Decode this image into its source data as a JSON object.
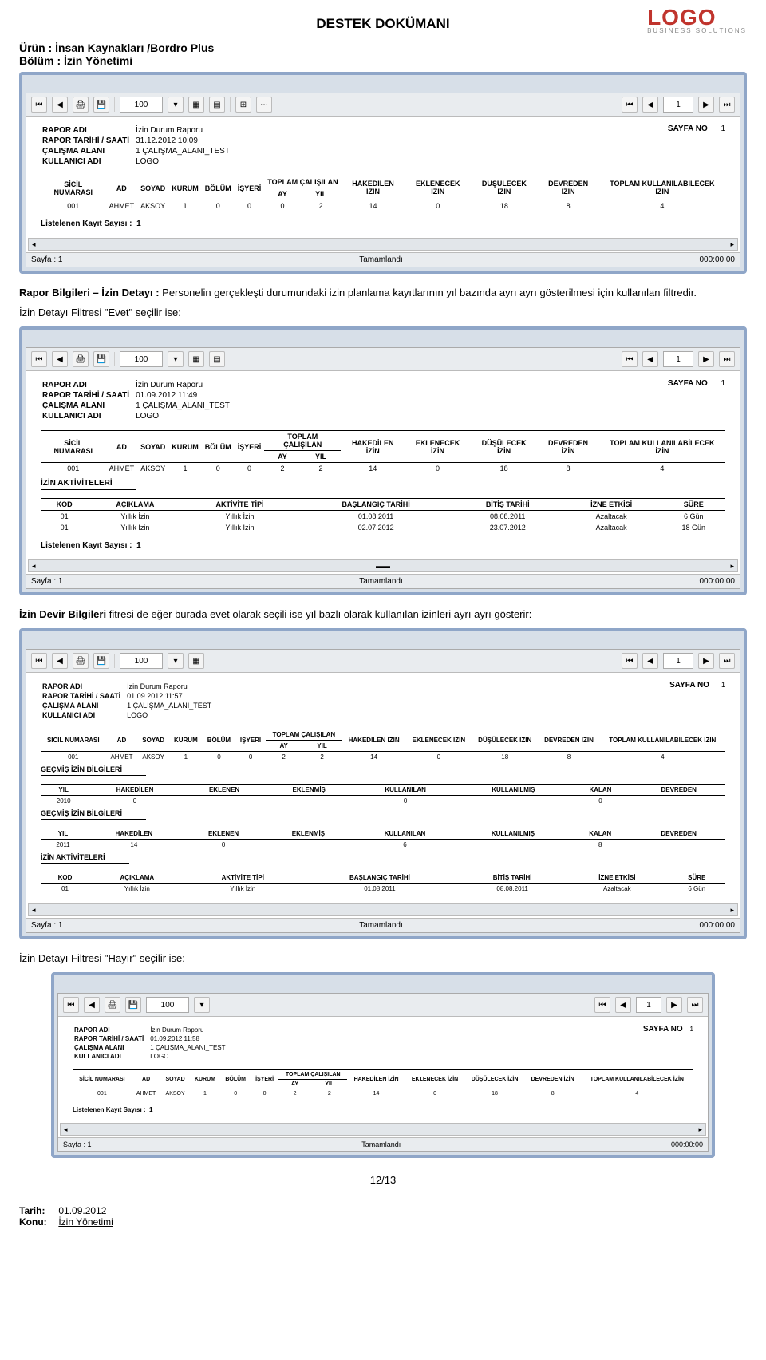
{
  "doc": {
    "title": "DESTEK DOKÜMANI",
    "product_label": "Ürün",
    "product_value": ": İnsan Kaynakları /Bordro Plus",
    "section_label": "Bölüm",
    "section_value": ": İzin Yönetimi",
    "logo_text": "LOGO",
    "logo_sub": "BUSINESS SOLUTIONS"
  },
  "paras": {
    "p1_label": "Rapor Bilgileri – İzin Detayı :",
    "p1_text": " Personelin gerçekleşti durumundaki izin planlama kayıtlarının yıl bazında ayrı ayrı gösterilmesi için kullanılan filtredir.",
    "p2": "İzin Detayı Filtresi \"Evet\" seçilir ise:",
    "p3_label": "İzin Devir Bilgileri",
    "p3_text": " fitresi de eğer burada evet olarak seçili ise yıl bazlı olarak kullanılan izinleri ayrı ayrı gösterir:",
    "p4": "İzin Detayı Filtresi \"Hayır\" seçilir ise:"
  },
  "toolbar": {
    "zoom": "100",
    "page": "1",
    "ic_first": "⏮",
    "ic_prev": "◀",
    "ic_next": "▶",
    "ic_last": "⏭",
    "ic_print": "🖨",
    "ic_save": "💾"
  },
  "report_common": {
    "k1": "RAPOR ADI",
    "k2": "RAPOR TARİHİ / SAATİ",
    "k3": "ÇALIŞMA ALANI",
    "k4": "KULLANICI ADI",
    "v1": "İzin Durum Raporu",
    "v3": "1     ÇALIŞMA_ALANI_TEST",
    "v4": "LOGO",
    "sayfa_l": "SAYFA NO",
    "sayfa_v": "1",
    "listed_l": "Listelenen Kayıt Sayısı :",
    "listed_v": "1"
  },
  "img1": {
    "date": "31.12.2012          10:09",
    "cols": [
      "SİCİL NUMARASI",
      "AD",
      "SOYAD",
      "KURUM",
      "BÖLÜM",
      "İŞYERİ",
      "TOPLAM ÇALIŞILAN",
      "HAKEDİLEN İZİN",
      "EKLENECEK İZİN",
      "DÜŞÜLECEK İZİN",
      "DEVREDEN İZİN",
      "TOPLAM KULLANILABİLECEK İZİN"
    ],
    "subay": "AY",
    "subyil": "YIL",
    "row": [
      "001",
      "AHMET",
      "AKSOY",
      "1",
      "0",
      "0",
      "2",
      "14",
      "0",
      "18",
      "8",
      "4"
    ]
  },
  "img2": {
    "date": "01.09.2012          11:49",
    "akt_title": "İZİN AKTİVİTELERİ",
    "akt_cols": [
      "KOD",
      "AÇIKLAMA",
      "AKTİVİTE TİPİ",
      "BAŞLANGIÇ TARİHİ",
      "BİTİŞ TARİHİ",
      "İZNE ETKİSİ",
      "SÜRE"
    ],
    "akt_rows": [
      [
        "01",
        "Yıllık İzin",
        "Yıllık İzin",
        "01.08.2011",
        "08.08.2011",
        "Azaltacak",
        "6 Gün"
      ],
      [
        "01",
        "Yıllık İzin",
        "Yıllık İzin",
        "02.07.2012",
        "23.07.2012",
        "Azaltacak",
        "18 Gün"
      ]
    ]
  },
  "img3": {
    "date": "01.09.2012          11:57",
    "gecmis_title": "GEÇMİŞ İZİN BİLGİLERİ",
    "gecmis_cols": [
      "YIL",
      "HAKEDİLEN",
      "EKLENEN",
      "EKLENMİŞ",
      "KULLANILAN",
      "KULLANILMIŞ",
      "KALAN",
      "DEVREDEN"
    ],
    "gecmis_rows": [
      [
        "2010",
        "0",
        "",
        "",
        "0",
        "",
        "0",
        ""
      ],
      [
        "2011",
        "14",
        "0",
        "",
        "6",
        "",
        "8",
        ""
      ]
    ],
    "gecmis2_title": "GEÇMİŞ İZİN BİLGİLERİ",
    "akt_title": "İZİN AKTİVİTELERİ",
    "akt_row": [
      "01",
      "Yıllık İzin",
      "Yıllık İzin",
      "01.08.2011",
      "08.08.2011",
      "Azaltacak",
      "6 Gün"
    ]
  },
  "img4": {
    "date": "01.09.2012          11:58"
  },
  "status": {
    "sayfa": "Sayfa : 1",
    "tam": "Tamamlandı",
    "time": "000:00:00"
  },
  "footer": {
    "page": "12/13",
    "tarih_l": "Tarih:",
    "tarih_v": "01.09.2012",
    "konu_l": "Konu:",
    "konu_v": "İzin Yönetimi"
  }
}
